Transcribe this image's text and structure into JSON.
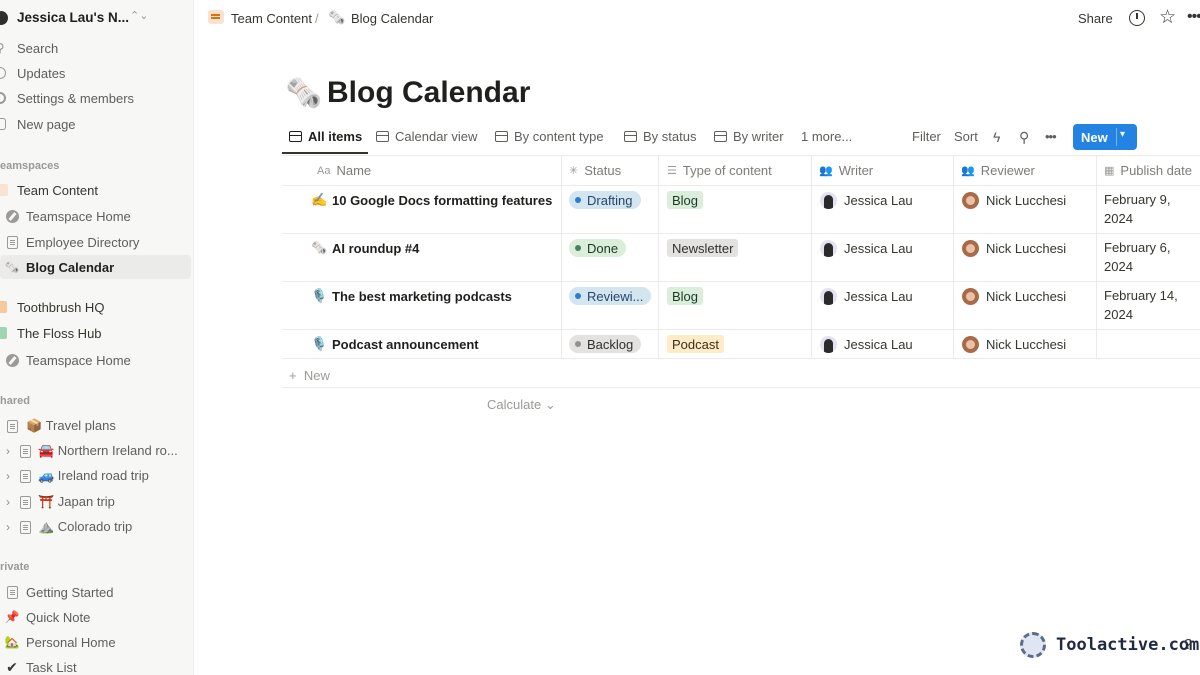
{
  "workspace": {
    "name": "Jessica Lau's N..."
  },
  "sidebar": {
    "top_items": [
      {
        "label": "Search",
        "icon": "search-icon"
      },
      {
        "label": "Updates",
        "icon": "clock-icon"
      },
      {
        "label": "Settings & members",
        "icon": "gear-icon"
      },
      {
        "label": "New page",
        "icon": "plus-icon"
      }
    ],
    "teamspaces_heading": "eamspaces",
    "teamspace_items": [
      {
        "label": "Team Content",
        "icon": "team-content-icon"
      },
      {
        "label": "Teamspace Home",
        "icon": "compass-icon"
      },
      {
        "label": "Employee Directory",
        "icon": "page-icon"
      },
      {
        "label": "Blog Calendar",
        "icon": "newspaper-icon"
      },
      {
        "label": "Toothbrush HQ",
        "icon": "toothbrush-icon"
      },
      {
        "label": "The Floss Hub",
        "icon": "floss-icon"
      },
      {
        "label": "Teamspace Home",
        "icon": "compass-icon"
      }
    ],
    "shared_heading": "hared",
    "shared_items": [
      {
        "label": "📦 Travel plans"
      },
      {
        "label": "🚘 Northern Ireland ro..."
      },
      {
        "label": "🚙 Ireland road trip"
      },
      {
        "label": "⛩️ Japan trip"
      },
      {
        "label": "⛰️ Colorado trip"
      }
    ],
    "private_heading": "rivate",
    "private_items": [
      {
        "label": "Getting Started",
        "icon": "page-icon"
      },
      {
        "label": "Quick Note",
        "icon": "pin-icon"
      },
      {
        "label": "Personal Home",
        "icon": "house-icon"
      },
      {
        "label": "Task List",
        "icon": "check-icon"
      }
    ]
  },
  "topbar": {
    "breadcrumb_team": "Team Content",
    "breadcrumb_sep": "/",
    "breadcrumb_page": "Blog Calendar",
    "share_label": "Share"
  },
  "page": {
    "emoji": "🗞️",
    "title": "Blog Calendar"
  },
  "views": {
    "tabs": [
      "All items",
      "Calendar view",
      "By content type",
      "By status",
      "By writer",
      "1 more..."
    ],
    "filter_label": "Filter",
    "sort_label": "Sort",
    "new_label": "New"
  },
  "table": {
    "headers": [
      "Name",
      "Status",
      "Type of content",
      "Writer",
      "Reviewer",
      "Publish date"
    ],
    "header_icons": [
      "Aa",
      "status-icon",
      "list-icon",
      "people-icon",
      "people-icon",
      "calendar-icon"
    ],
    "rows": [
      {
        "icon": "✍️",
        "name": "10 Google Docs formatting features",
        "status": "Drafting",
        "type": "Blog",
        "writer": "Jessica Lau",
        "reviewer": "Nick Lucchesi",
        "date_line1": "February 9,",
        "date_line2": "2024"
      },
      {
        "icon": "🗞️",
        "name": "AI roundup #4",
        "status": "Done",
        "type": "Newsletter",
        "writer": "Jessica Lau",
        "reviewer": "Nick Lucchesi",
        "date_line1": "February 6,",
        "date_line2": "2024"
      },
      {
        "icon": "🎙️",
        "name": "The best marketing podcasts",
        "status": "Reviewi...",
        "type": "Blog",
        "writer": "Jessica Lau",
        "reviewer": "Nick Lucchesi",
        "date_line1": "February 14,",
        "date_line2": "2024"
      },
      {
        "icon": "🎙️",
        "name": "Podcast announcement",
        "status": "Backlog",
        "type": "Podcast",
        "writer": "Jessica Lau",
        "reviewer": "Nick Lucchesi",
        "date_line1": "",
        "date_line2": ""
      }
    ],
    "add_row_label": "New",
    "calculate_label": "Calculate"
  },
  "colors": {
    "accent": "#2383e2",
    "status_drafting_bg": "#d3e5ef",
    "status_drafting_dot": "#2e7cd1",
    "status_done_bg": "#dbeddb",
    "status_done_dot": "#448361",
    "status_reviewing_bg": "#d3e5ef",
    "status_reviewing_dot": "#2e7cd1",
    "status_backlog_bg": "#e3e2e0",
    "status_backlog_dot": "#91918e",
    "tag_blog_bg": "#dbeddb",
    "tag_newsletter_bg": "#e3e2e0",
    "tag_podcast_bg": "#fdecc8"
  },
  "watermark": {
    "text": "Toolactive.com",
    "help": "?"
  }
}
